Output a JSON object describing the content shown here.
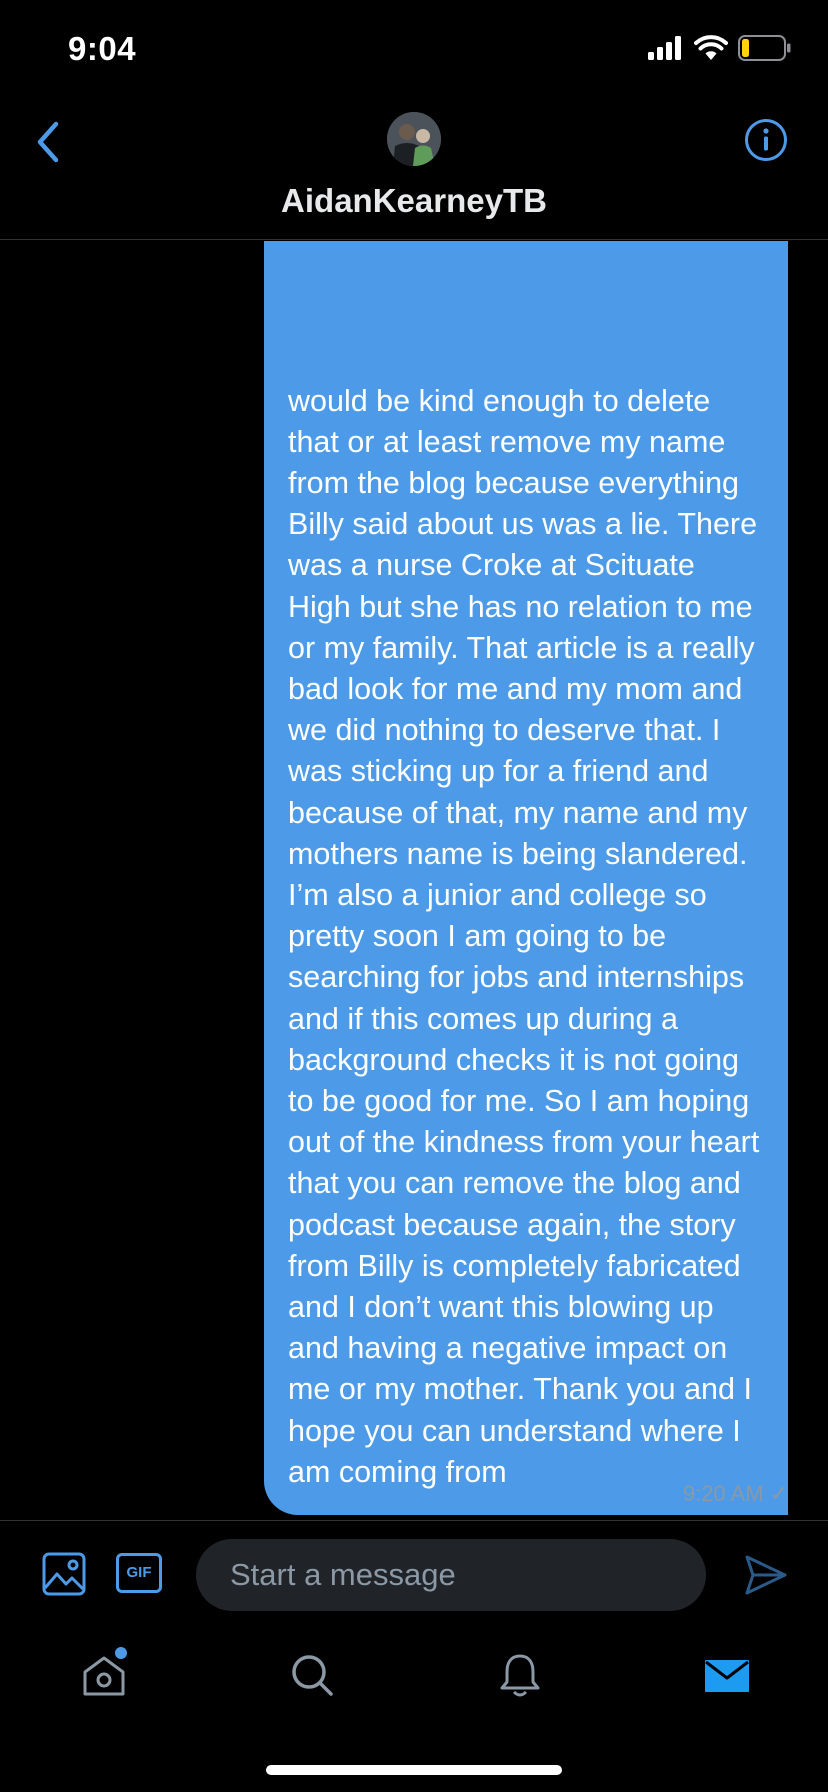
{
  "status_bar": {
    "time": "9:04",
    "icons": [
      "cellular-signal-icon",
      "wifi-icon",
      "battery-low-icon"
    ]
  },
  "header": {
    "title": "AidanKearneyTB",
    "icons": [
      "back-chevron-icon",
      "avatar",
      "info-icon"
    ]
  },
  "message": {
    "text": "would be kind enough to delete that or at least remove my name from the blog because everything Billy said about us was a lie. There was a nurse Croke at Scituate High but she has no relation to me or my family. That article is a really bad look for me and my mom and we did nothing to deserve that. I was sticking up for a friend and because of that, my name and my mothers name is being slandered. I’m also a junior and college so pretty soon I am going to be searching for jobs and internships and if this comes up during a background checks it is not going to be good for me. So I am hoping out of the kindness from your heart that you can remove the blog and podcast because again, the story from Billy is completely fabricated and I don’t want this blowing up and having a negative impact on me or my mother. Thank you and I hope you can understand where I am coming from",
    "time": "9:20 AM",
    "status_mark": "✓"
  },
  "composer": {
    "placeholder": "Start a message",
    "gif_label": "GIF"
  },
  "tabbar": {
    "items": [
      "home-icon",
      "search-icon",
      "notifications-bell-icon",
      "messages-envelope-icon"
    ],
    "active": "messages-envelope-icon"
  },
  "colors": {
    "accent": "#4d9be8",
    "background": "#000000",
    "input_bg": "#202327",
    "muted": "#8b98a5"
  }
}
